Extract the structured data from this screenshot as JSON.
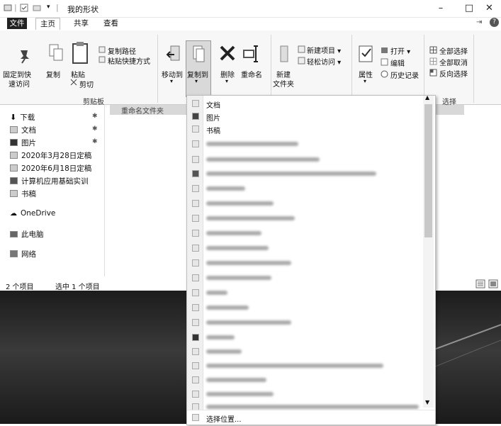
{
  "window": {
    "title": "我的形状",
    "minimize": "–",
    "maximize": "□",
    "close": "✕",
    "help": "?"
  },
  "tabs": [
    {
      "label": "文件"
    },
    {
      "label": "主页"
    },
    {
      "label": "共享"
    },
    {
      "label": "查看"
    }
  ],
  "ribbon": {
    "pin": "固定到快",
    "pin2": "速访问",
    "copy": "复制",
    "paste": "粘贴",
    "copy_path": "复制路径",
    "paste_shortcut": "粘贴快捷方式",
    "cut": "剪切",
    "clipboard_group": "剪贴板",
    "move_to": "移动到",
    "copy_to": "复制到",
    "delete": "删除",
    "rename": "重命名",
    "new_folder": "新建",
    "new_folder2": "文件夹",
    "new_item": "新建项目 ▾",
    "easy_access": "轻松访问 ▾",
    "properties": "属性",
    "open": "打开 ▾",
    "edit": "编辑",
    "history": "历史记录",
    "select_all": "全部选择",
    "select_none": "全部取消",
    "invert": "反向选择",
    "select_group": "选择"
  },
  "nav": {
    "items": [
      {
        "label": "下载",
        "pinned": true
      },
      {
        "label": "文档",
        "pinned": true
      },
      {
        "label": "图片",
        "pinned": true
      },
      {
        "label": "2020年3月28日定稿",
        "pinned": false
      },
      {
        "label": "2020年6月18日定稿",
        "pinned": false
      },
      {
        "label": "计算机应用基础实训",
        "pinned": false
      },
      {
        "label": "书稿",
        "pinned": false
      },
      {
        "label": "OneDrive",
        "pinned": false
      },
      {
        "label": "此电脑",
        "pinned": false
      },
      {
        "label": "网络",
        "pinned": false
      }
    ],
    "pin_symbol": "✱"
  },
  "content": {
    "row1": "重命名文件夹"
  },
  "status": {
    "count": "2 个项目",
    "selected": "选中 1 个项目"
  },
  "dropdown": {
    "items": [
      {
        "label": "文档"
      },
      {
        "label": "图片"
      },
      {
        "label": "书稿"
      }
    ],
    "choose_location": "选择位置..."
  }
}
